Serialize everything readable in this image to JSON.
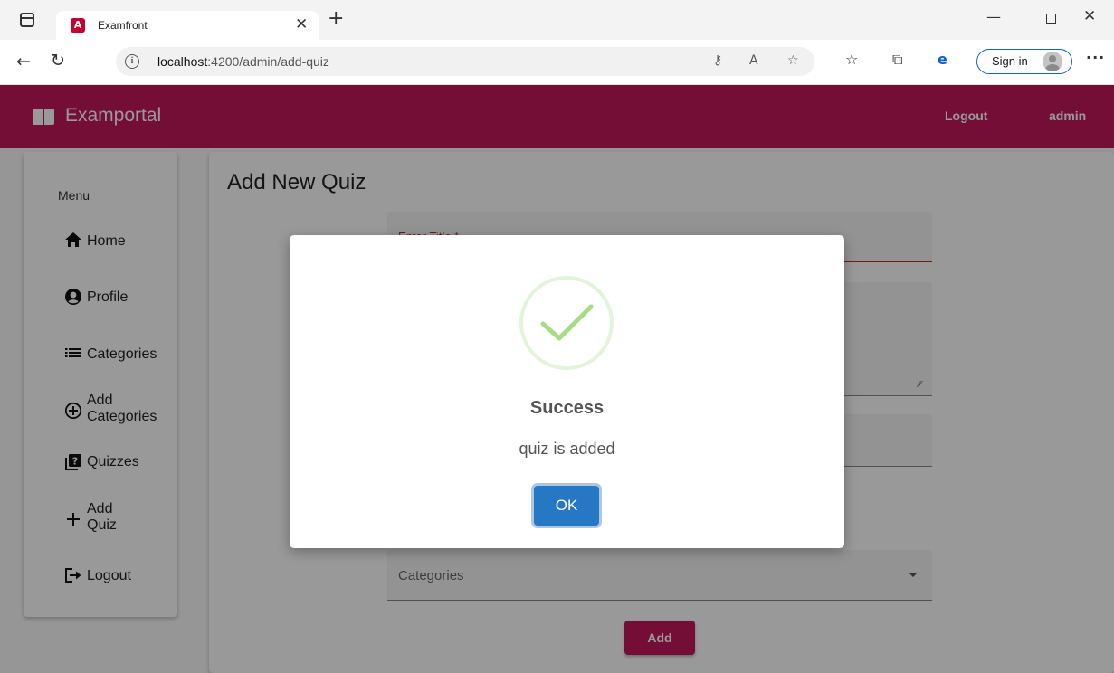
{
  "browser": {
    "tab_title": "Examfront",
    "tab_favicon_letter": "A",
    "url_host": "localhost",
    "url_path": ":4200/admin/add-quiz",
    "signin_label": "Sign in"
  },
  "navbar": {
    "brand": "Examportal",
    "links": [
      "Logout",
      "admin"
    ],
    "color": "#c2185b"
  },
  "sidebar": {
    "title": "Menu",
    "items": [
      {
        "label": "Home",
        "icon": "home-icon"
      },
      {
        "label": "Profile",
        "icon": "account-circle-icon"
      },
      {
        "label": "Categories",
        "icon": "list-icon"
      },
      {
        "label_line1": "Add",
        "label_line2": "Categories",
        "icon": "add-circle-icon"
      },
      {
        "label": "Quizzes",
        "icon": "quiz-icon"
      },
      {
        "label_line1": "Add",
        "label_line2": "Quiz",
        "icon": "plus-icon"
      },
      {
        "label": "Logout",
        "icon": "logout-icon"
      }
    ]
  },
  "main": {
    "page_title": "Add New Quiz",
    "title_field_label": "Enter Title *",
    "categories_placeholder": "Categories",
    "add_button": "Add"
  },
  "modal": {
    "title": "Success",
    "text": "quiz is added",
    "ok_button": "OK",
    "success_color": "#a5dc86",
    "button_color": "#2778c4"
  }
}
